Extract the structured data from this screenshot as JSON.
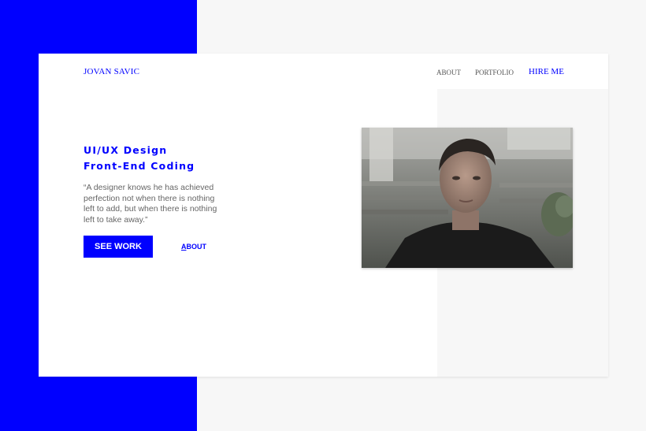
{
  "brand": {
    "name": "JOVAN SAVIC"
  },
  "nav": {
    "about": "ABOUT",
    "portfolio": "PORTFOLIO",
    "hire": "HIRE ME"
  },
  "hero": {
    "headline_line1": "UI/UX Design",
    "headline_line2": "Front-End Coding",
    "quote": "“A designer knows he has achieved perfection not when there is nothing left to add, but when there is nothing left to take away.”",
    "see_work_label": "SEE WORK",
    "about_link_first": "A",
    "about_link_rest": "BOUT"
  },
  "colors": {
    "accent": "#0000ff",
    "background": "#f7f7f7",
    "card": "#ffffff",
    "body_text": "#666666"
  },
  "photo": {
    "icon": "portrait-photo"
  }
}
